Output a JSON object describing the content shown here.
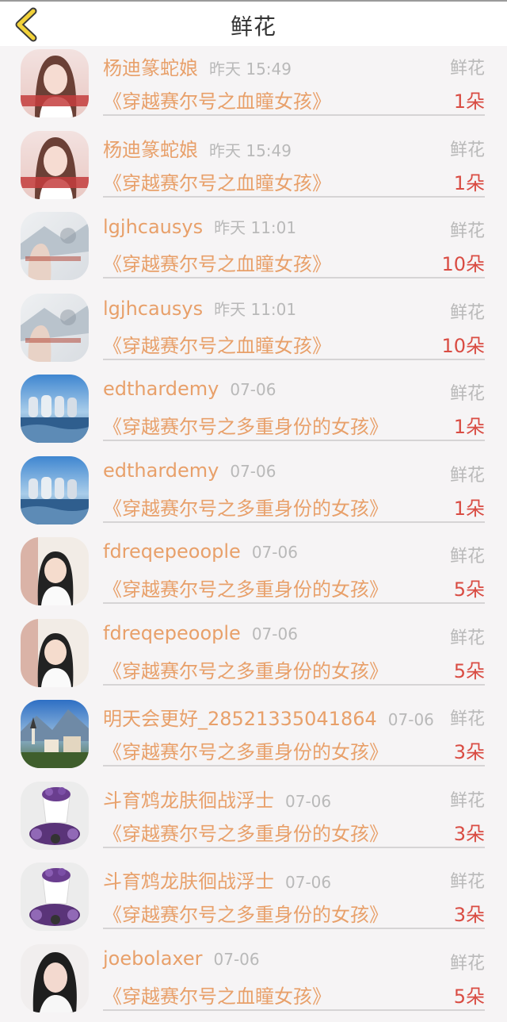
{
  "header": {
    "title": "鲜花"
  },
  "rows": [
    {
      "user": "杨迪篆蛇娘",
      "time": "昨天 15:49",
      "type": "鲜花",
      "book": "《穿越赛尔号之血瞳女孩》",
      "count": "1朵",
      "avatar": "pink-girl"
    },
    {
      "user": "杨迪篆蛇娘",
      "time": "昨天 15:49",
      "type": "鲜花",
      "book": "《穿越赛尔号之血瞳女孩》",
      "count": "1朵",
      "avatar": "pink-girl"
    },
    {
      "user": "lgjhcausys",
      "time": "昨天 11:01",
      "type": "鲜花",
      "book": "《穿越赛尔号之血瞳女孩》",
      "count": "10朵",
      "avatar": "snow"
    },
    {
      "user": "lgjhcausys",
      "time": "昨天 11:01",
      "type": "鲜花",
      "book": "《穿越赛尔号之血瞳女孩》",
      "count": "10朵",
      "avatar": "snow"
    },
    {
      "user": "edthardemy",
      "time": "07-06",
      "type": "鲜花",
      "book": "《穿越赛尔号之多重身份的女孩》",
      "count": "1朵",
      "avatar": "sea"
    },
    {
      "user": "edthardemy",
      "time": "07-06",
      "type": "鲜花",
      "book": "《穿越赛尔号之多重身份的女孩》",
      "count": "1朵",
      "avatar": "sea"
    },
    {
      "user": "fdreqepeoople",
      "time": "07-06",
      "type": "鲜花",
      "book": "《穿越赛尔号之多重身份的女孩》",
      "count": "5朵",
      "avatar": "child"
    },
    {
      "user": "fdreqepeoople",
      "time": "07-06",
      "type": "鲜花",
      "book": "《穿越赛尔号之多重身份的女孩》",
      "count": "5朵",
      "avatar": "child"
    },
    {
      "user": "明天会更好_28521335041864",
      "time": "07-06",
      "type": "鲜花",
      "book": "《穿越赛尔号之多重身份的女孩》",
      "count": "3朵",
      "avatar": "town"
    },
    {
      "user": "斗育鸩龙肤徊战浮士",
      "time": "07-06",
      "type": "鲜花",
      "book": "《穿越赛尔号之多重身份的女孩》",
      "count": "3朵",
      "avatar": "flowers"
    },
    {
      "user": "斗育鸩龙肤徊战浮士",
      "time": "07-06",
      "type": "鲜花",
      "book": "《穿越赛尔号之多重身份的女孩》",
      "count": "3朵",
      "avatar": "flowers"
    },
    {
      "user": "joebolaxer",
      "time": "07-06",
      "type": "鲜花",
      "book": "《穿越赛尔号之血瞳女孩》",
      "count": "5朵",
      "avatar": "portrait"
    }
  ]
}
